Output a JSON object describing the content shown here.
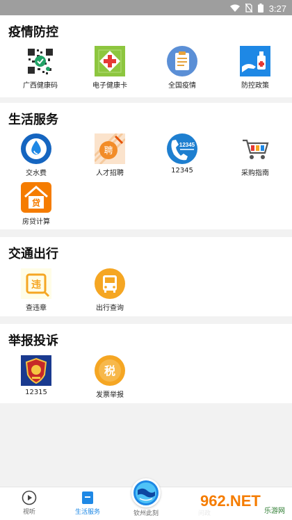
{
  "status": {
    "time": "3:27"
  },
  "sections": [
    {
      "title": "疫情防控",
      "items": [
        {
          "label": "广西健康码",
          "icon": "health-qr-code-icon"
        },
        {
          "label": "电子健康卡",
          "icon": "health-card-icon"
        },
        {
          "label": "全国疫情",
          "icon": "clipboard-icon"
        },
        {
          "label": "防控政策",
          "icon": "sanitizer-icon"
        }
      ]
    },
    {
      "title": "生活服务",
      "items": [
        {
          "label": "交水费",
          "icon": "water-drop-icon"
        },
        {
          "label": "人才招聘",
          "icon": "recruit-icon"
        },
        {
          "label": "12345",
          "icon": "hotline-phone-icon"
        },
        {
          "label": "采购指南",
          "icon": "shopping-cart-icon"
        },
        {
          "label": "房贷计算",
          "icon": "house-loan-icon"
        }
      ]
    },
    {
      "title": "交通出行",
      "items": [
        {
          "label": "查违章",
          "icon": "violation-icon"
        },
        {
          "label": "出行查询",
          "icon": "bus-icon"
        }
      ]
    },
    {
      "title": "举报投诉",
      "items": [
        {
          "label": "12315",
          "icon": "emblem-icon"
        },
        {
          "label": "发票举报",
          "icon": "tax-icon"
        }
      ]
    }
  ],
  "icon_text": {
    "hotline": "12345",
    "loan": "贷",
    "recruit": "聘",
    "violation": "违",
    "tax": "税"
  },
  "nav": [
    {
      "label": "视听",
      "icon": "play-circle-icon",
      "active": false
    },
    {
      "label": "生活服务",
      "icon": "services-icon",
      "active": true
    },
    {
      "label": "钦州此刻",
      "icon": "globe-icon",
      "active": false
    },
    {
      "label": "问政",
      "icon": "question-icon",
      "active": false
    }
  ],
  "watermark": {
    "text": "962.NET",
    "sub": "乐游网"
  },
  "colors": {
    "accent": "#1e88e5",
    "orange": "#f5a623",
    "bg": "#f2f2f2"
  }
}
